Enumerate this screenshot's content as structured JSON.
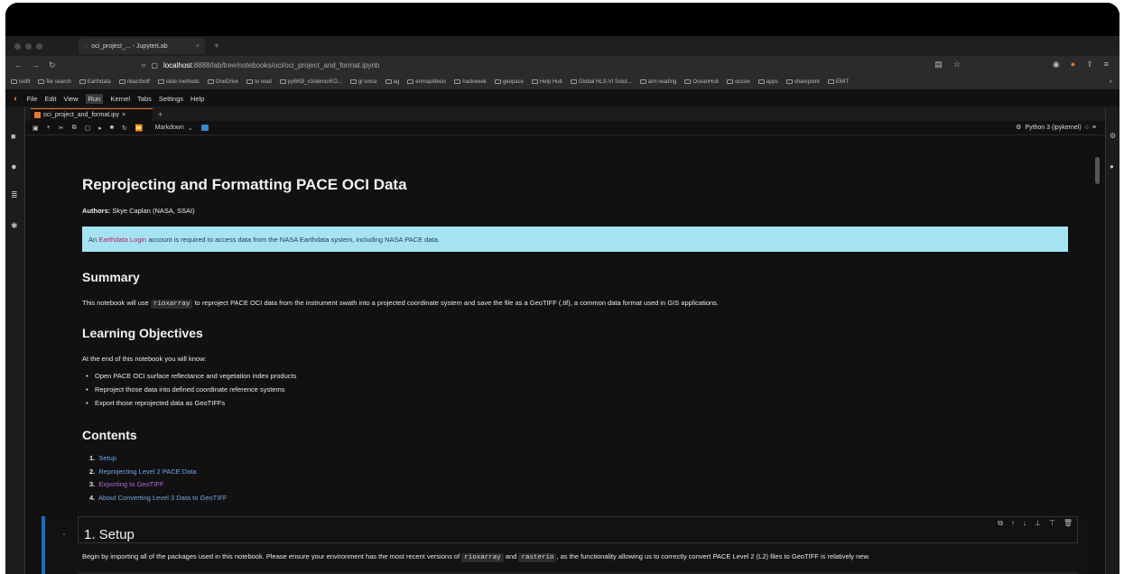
{
  "browser": {
    "tab_title": "oci_project_... - JupyterLab",
    "tab_close": "×",
    "new_tab": "+",
    "url_host": "localhost",
    "url_path": ":8888/lab/tree/notebooks/oci/oci_project_and_format.ipynb",
    "bookmarks": [
      "isofit",
      "file search",
      "Earthdata",
      "nbac/brdf",
      "slide methods",
      "OneDrive",
      "to read",
      "pyBKB_v3/demo/KO...",
      "gl smce",
      "ag",
      "enmap/desis",
      "hackweek",
      "geopace",
      "Help Hub",
      "Global HLS-VI Solut...",
      "atm reading",
      "OceanHub",
      "ocssw",
      "apps",
      "sharepoint",
      "EMIT"
    ],
    "bookmarks_overflow": "»"
  },
  "menubar": {
    "items": [
      "File",
      "Edit",
      "View",
      "Run",
      "Kernel",
      "Tabs",
      "Settings",
      "Help"
    ]
  },
  "notebook_tab": {
    "title": "oci_project_and_format.ipy",
    "close": "×",
    "add": "+"
  },
  "toolbar": {
    "cell_type": "Markdown",
    "kernel": "Python 3 (ipykernel)"
  },
  "notebook": {
    "title": "Reprojecting and Formatting PACE OCI Data",
    "authors_label": "Authors:",
    "authors_value": " Skye Caplan (NASA, SSAI)",
    "note_prefix": "An ",
    "note_link": "Earthdata Login",
    "note_suffix": " account is required to access data from the NASA Earthdata system, including NASA PACE data.",
    "summary_heading": "Summary",
    "summary_pre": "This notebook will use ",
    "summary_code": "rioxarray",
    "summary_post": " to reproject PACE OCI data from the instrument swath into a projected coordinate system and save the file as a GeoTIFF (.tif), a common data format used in GIS applications.",
    "objectives_heading": "Learning Objectives",
    "objectives_intro": "At the end of this notebook you will know:",
    "objectives": [
      "Open PACE OCI surface reflectance and vegetation index products",
      "Reproject those data into defined coordinate reference systems",
      "Export those reprojected data as GeoTIFFs"
    ],
    "contents_heading": "Contents",
    "contents": [
      {
        "num": "1.",
        "text": "Setup"
      },
      {
        "num": "2.",
        "text": "Reprojecting Level 2 PACE Data"
      },
      {
        "num": "3.",
        "text": "Exporting to GeoTIFF"
      },
      {
        "num": "4.",
        "text": "About Converting Level 3 Data to GeoTIFF"
      }
    ],
    "setup_heading": "1. Setup",
    "setup_pre": "Begin by importing all of the packages used in this notebook. Please ensure your environment has the most recent versions of ",
    "setup_code1": "rioxarray",
    "setup_mid": " and ",
    "setup_code2": "rasterio",
    "setup_post": ", as the functionality allowing us to correctly convert PACE Level 2 (L2) files to GeoTIFF is relatively new."
  }
}
